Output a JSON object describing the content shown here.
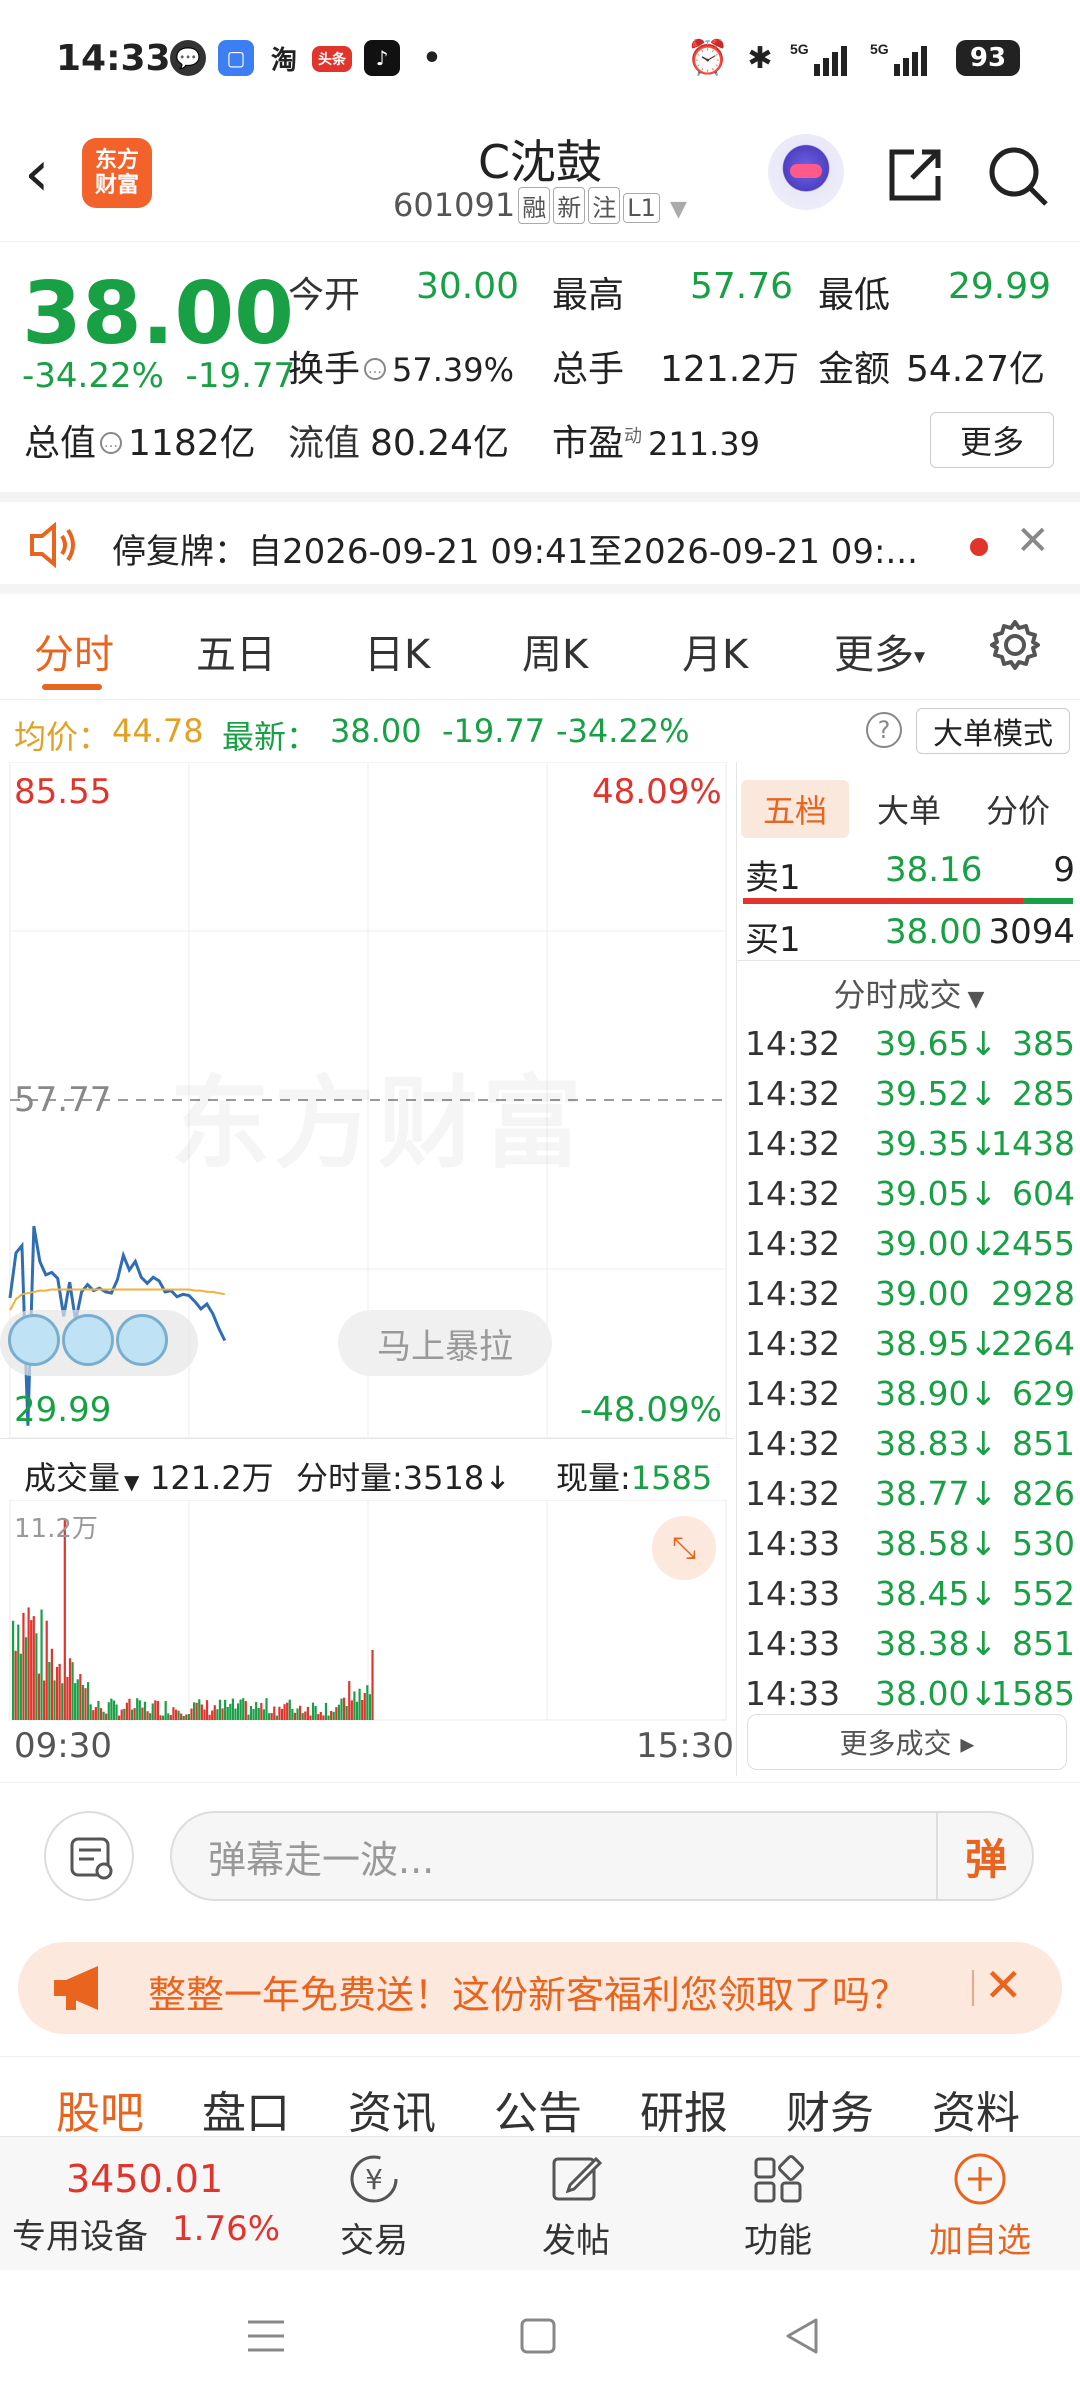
{
  "status_bar": {
    "time": "14:33",
    "battery": "93",
    "network1": "5G",
    "network2": "5G"
  },
  "header": {
    "logo_line1": "东方",
    "logo_line2": "财富",
    "stock_name": "C沈鼓",
    "stock_code": "601091",
    "tags": [
      "融",
      "新",
      "注",
      "L1"
    ]
  },
  "quote": {
    "price": "38.00",
    "change_pct": "-34.22%",
    "change": "-19.77",
    "open_label": "今开",
    "open": "30.00",
    "high_label": "最高",
    "high": "57.76",
    "low_label": "最低",
    "low": "29.99",
    "turnover_label": "换手",
    "turnover": "57.39%",
    "volume_label": "总手",
    "volume": "121.2万",
    "amount_label": "金额",
    "amount": "54.27亿",
    "mktcap_label": "总值",
    "mktcap": "1182亿",
    "float_label": "流值",
    "float": "80.24亿",
    "pe_label": "市盈",
    "pe_sup": "动",
    "pe": "211.39",
    "more": "更多"
  },
  "notice": {
    "text": "停复牌：自2026-09-21 09:41至2026-09-21 09:..."
  },
  "tabs": [
    "分时",
    "五日",
    "日K",
    "周K",
    "月K",
    "更多"
  ],
  "avg_line": {
    "avg_label": "均价：",
    "avg": "44.78",
    "latest_label": "最新：",
    "latest": "38.00",
    "change": "-19.77",
    "change_pct": "-34.22%",
    "help": "?",
    "big_mode": "大单模式"
  },
  "chart": {
    "y_top": "85.55",
    "pct_top": "48.09%",
    "y_mid": "57.77",
    "y_bottom": "29.99",
    "pct_bottom": "-48.09%",
    "watermark": "东方财富",
    "pull_button": "马上暴拉",
    "time_start": "09:30",
    "time_end": "15:30"
  },
  "chart_data": {
    "type": "line",
    "title": "",
    "xlabel": "",
    "ylabel": "",
    "ylim": [
      29.99,
      85.55
    ],
    "prev_close": 57.77,
    "x": [
      0,
      2,
      4,
      6,
      8,
      10,
      12,
      14,
      16,
      18,
      20,
      22,
      24,
      26,
      28,
      30,
      32,
      34,
      36,
      38,
      40,
      42,
      44,
      46,
      48,
      50,
      52,
      54,
      56,
      58,
      60,
      62,
      64,
      66,
      68,
      70,
      72
    ],
    "series": [
      {
        "values": [
          41.5,
          45.2,
          45.8,
          31.0,
          47.4,
          44.5,
          43.4,
          43.6,
          43.1,
          40.0,
          42.8,
          39.6,
          42.0,
          42.6,
          42.1,
          42.3,
          42.0,
          41.9,
          43.0,
          45.0,
          43.8,
          44.5,
          43.2,
          42.7,
          43.2,
          42.9,
          42.0,
          42.1,
          41.6,
          41.8,
          41.7,
          41.2,
          40.6,
          41.0,
          40.2,
          39.0,
          38.0
        ]
      },
      {
        "values": [
          40.5,
          41.4,
          41.8,
          41.9,
          42.0,
          42.1,
          42.1,
          42.2,
          42.2,
          42.2,
          42.2,
          42.2,
          42.2,
          42.2,
          42.2,
          42.2,
          42.2,
          42.2,
          42.2,
          42.2,
          42.2,
          42.2,
          42.2,
          42.2,
          42.2,
          42.2,
          42.2,
          42.2,
          42.2,
          42.2,
          42.2,
          42.1,
          42.1,
          42.0,
          42.0,
          41.9,
          41.8
        ]
      }
    ],
    "volume_max_label": "11.2万"
  },
  "volume_head": {
    "label": "成交量",
    "total": "121.2万",
    "tick_label": "分时量:",
    "tick": "3518",
    "now_label": "现量:",
    "now": "1585"
  },
  "book": {
    "tabs": [
      "五档",
      "大单",
      "分价"
    ],
    "sell1_label": "卖1",
    "sell1_price": "38.16",
    "sell1_vol": "9",
    "buy1_label": "买1",
    "buy1_price": "38.00",
    "buy1_vol": "3094",
    "ticks_title": "分时成交",
    "ticks": [
      {
        "t": "14:32",
        "p": "39.65↓",
        "v": "385"
      },
      {
        "t": "14:32",
        "p": "39.52↓",
        "v": "285"
      },
      {
        "t": "14:32",
        "p": "39.35↓",
        "v": "1438"
      },
      {
        "t": "14:32",
        "p": "39.05↓",
        "v": "604"
      },
      {
        "t": "14:32",
        "p": "39.00↓",
        "v": "2455"
      },
      {
        "t": "14:32",
        "p": "39.00",
        "v": "2928"
      },
      {
        "t": "14:32",
        "p": "38.95↓",
        "v": "2264"
      },
      {
        "t": "14:32",
        "p": "38.90↓",
        "v": "629"
      },
      {
        "t": "14:32",
        "p": "38.83↓",
        "v": "851"
      },
      {
        "t": "14:32",
        "p": "38.77↓",
        "v": "826"
      },
      {
        "t": "14:33",
        "p": "38.58↓",
        "v": "530"
      },
      {
        "t": "14:33",
        "p": "38.45↓",
        "v": "552"
      },
      {
        "t": "14:33",
        "p": "38.38↓",
        "v": "851"
      },
      {
        "t": "14:33",
        "p": "38.00↓",
        "v": "1585"
      }
    ],
    "more_deals": "更多成交 ▸"
  },
  "comment": {
    "placeholder": "弹幕走一波...",
    "dan": "弹"
  },
  "promo": {
    "text": "整整一年免费送！这份新客福利您领取了吗？"
  },
  "bottom_tabs": [
    "股吧",
    "盘口",
    "资讯",
    "公告",
    "研报",
    "财务",
    "资料"
  ],
  "toolbar": {
    "index_value": "3450.01",
    "index_name": "专用设备",
    "index_pct": "1.76%",
    "trade": "交易",
    "post": "发帖",
    "func": "功能",
    "add": "加自选"
  },
  "colors": {
    "accent": "#e8641f",
    "up": "#e0342c",
    "down": "#19a045",
    "line": "#2f6db5",
    "avg": "#f0b23c"
  }
}
